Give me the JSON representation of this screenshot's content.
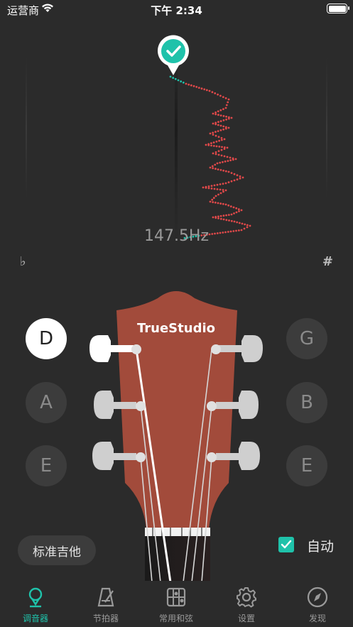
{
  "status": {
    "carrier": "运营商",
    "time": "下午 2:34"
  },
  "tuner": {
    "frequency": "147.5Hz",
    "flat": "♭",
    "sharp": "#",
    "in_tune": true
  },
  "headstock": {
    "brand": "TrueStudio"
  },
  "strings": {
    "left": [
      {
        "note": "D",
        "active": true
      },
      {
        "note": "A",
        "active": false
      },
      {
        "note": "E",
        "active": false
      }
    ],
    "right": [
      {
        "note": "G",
        "active": false
      },
      {
        "note": "B",
        "active": false
      },
      {
        "note": "E",
        "active": false
      }
    ]
  },
  "tuning_mode": "标准吉他",
  "auto": {
    "label": "自动",
    "checked": true
  },
  "tabs": [
    {
      "label": "调音器",
      "icon": "tuner-pin-icon",
      "active": true
    },
    {
      "label": "节拍器",
      "icon": "metronome-icon",
      "active": false
    },
    {
      "label": "常用和弦",
      "icon": "chord-grid-icon",
      "active": false
    },
    {
      "label": "设置",
      "icon": "gear-icon",
      "active": false
    },
    {
      "label": "发现",
      "icon": "compass-icon",
      "active": false
    }
  ],
  "colors": {
    "accent": "#1fc2aa",
    "pitch_off": "#e0494a",
    "headstock": "#a24b3b"
  }
}
